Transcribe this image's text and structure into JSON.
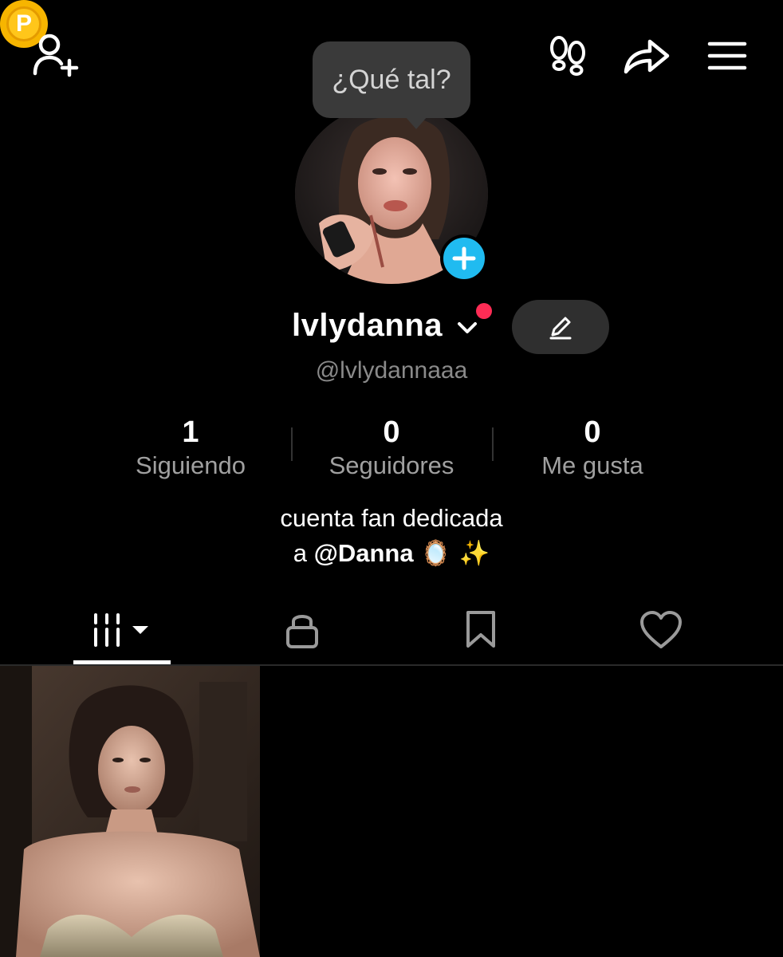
{
  "top_bar": {
    "add_friend_icon": "add-user-icon",
    "coin_icon": "points-coin-icon",
    "coin_letter": "P",
    "footprints_icon": "footprints-icon",
    "share_icon": "share-arrow-icon",
    "menu_icon": "hamburger-menu-icon"
  },
  "status_bubble": {
    "text": "¿Qué tal?"
  },
  "profile": {
    "display_name": "lvlydanna",
    "username": "@lvlydannaaa",
    "avatar": "profile-photo"
  },
  "stats": [
    {
      "value": "1",
      "label": "Siguiendo"
    },
    {
      "value": "0",
      "label": "Seguidores"
    },
    {
      "value": "0",
      "label": "Me gusta"
    }
  ],
  "bio": {
    "line1": "cuenta fan dedicada",
    "line2_prefix": "a ",
    "mention": "@Danna",
    "emojis": "🪞 ✨"
  },
  "tabs": [
    {
      "name": "videos",
      "icon": "grid-bars-icon",
      "active": true
    },
    {
      "name": "private",
      "icon": "lock-icon"
    },
    {
      "name": "saved",
      "icon": "bookmark-icon"
    },
    {
      "name": "liked",
      "icon": "heart-icon"
    }
  ],
  "colors": {
    "background": "#000000",
    "accent_blue": "#20bbf0",
    "notification_red": "#fe2c55",
    "coin": "#f7b500"
  }
}
